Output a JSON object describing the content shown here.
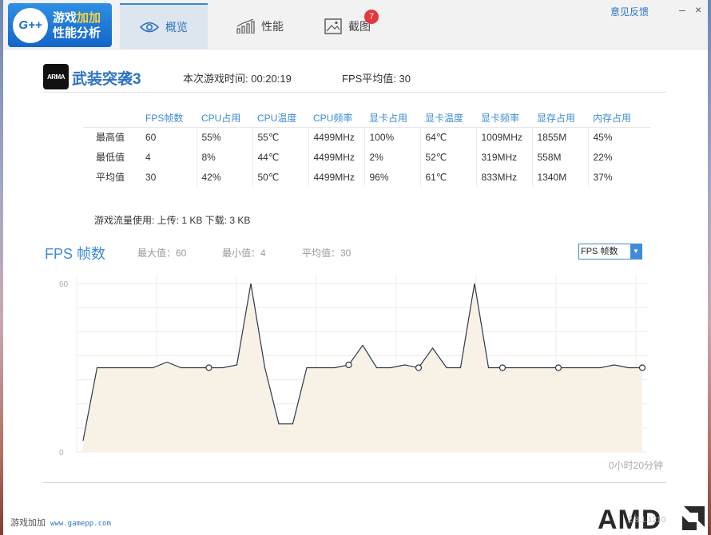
{
  "app": {
    "logo_badge": "G++",
    "logo_line1_a": "游戏",
    "logo_line1_b": "加加",
    "logo_line2": "性能分析",
    "feedback": "意见反馈",
    "minimize": "–",
    "close": "×"
  },
  "tabs": [
    {
      "label": "概览",
      "icon": "eye-icon",
      "active": true
    },
    {
      "label": "性能",
      "icon": "bar-chart-icon",
      "active": false
    },
    {
      "label": "截图",
      "icon": "image-icon",
      "active": false,
      "badge": "7"
    }
  ],
  "game": {
    "icon_text": "ARMA",
    "name": "武装突袭3",
    "play_time": "本次游戏时间: 00:20:19",
    "fps_avg": "FPS平均值: 30"
  },
  "stats": {
    "headers": [
      "FPS帧数",
      "CPU占用",
      "CPU温度",
      "CPU频率",
      "显卡占用",
      "显卡温度",
      "显卡频率",
      "显存占用",
      "内存占用"
    ],
    "rows": [
      {
        "label": "最高值",
        "values": [
          "60",
          "55%",
          "55℃",
          "4499MHz",
          "100%",
          "64℃",
          "1009MHz",
          "1855M",
          "45%"
        ]
      },
      {
        "label": "最低值",
        "values": [
          "4",
          "8%",
          "44℃",
          "4499MHz",
          "2%",
          "52℃",
          "319MHz",
          "558M",
          "22%"
        ]
      },
      {
        "label": "平均值",
        "values": [
          "30",
          "42%",
          "50℃",
          "4499MHz",
          "96%",
          "61℃",
          "833MHz",
          "1340M",
          "37%"
        ]
      }
    ]
  },
  "traffic": "游戏流量使用: 上传: 1 KB    下载: 3 KB",
  "fps_section": {
    "title": "FPS 帧数",
    "max": "最大值：60",
    "min": "最小值：4",
    "avg": "平均值：30",
    "select_value": "FPS 帧数"
  },
  "chart_data": {
    "type": "area",
    "x": [
      0,
      1,
      2,
      3,
      4,
      5,
      6,
      7,
      8,
      9,
      10,
      11,
      12,
      13,
      14,
      15,
      16,
      17,
      18,
      19,
      20,
      21,
      22,
      23,
      24,
      25,
      26,
      27,
      28,
      29,
      30,
      31,
      32,
      33,
      34,
      35,
      36,
      37,
      38,
      39,
      40
    ],
    "values": [
      4,
      30,
      30,
      30,
      30,
      30,
      32,
      30,
      30,
      30,
      30,
      31,
      60,
      30,
      10,
      10,
      30,
      30,
      30,
      31,
      38,
      30,
      30,
      31,
      30,
      37,
      30,
      30,
      60,
      30,
      30,
      30,
      30,
      30,
      30,
      30,
      30,
      30,
      31,
      30,
      30
    ],
    "markers": [
      9,
      19,
      24,
      30,
      34,
      40
    ],
    "ylim": [
      0,
      60
    ],
    "yticks": [
      0,
      60
    ],
    "x_end_label": "0小时20分钟",
    "grid": true,
    "line_color": "#2d3a4a",
    "fill_color": "#f7f1e6"
  },
  "footer": {
    "name": "游戏加加",
    "url": "www.gamepp.com",
    "amd": "AMD",
    "version": "2.8.1.1210"
  }
}
